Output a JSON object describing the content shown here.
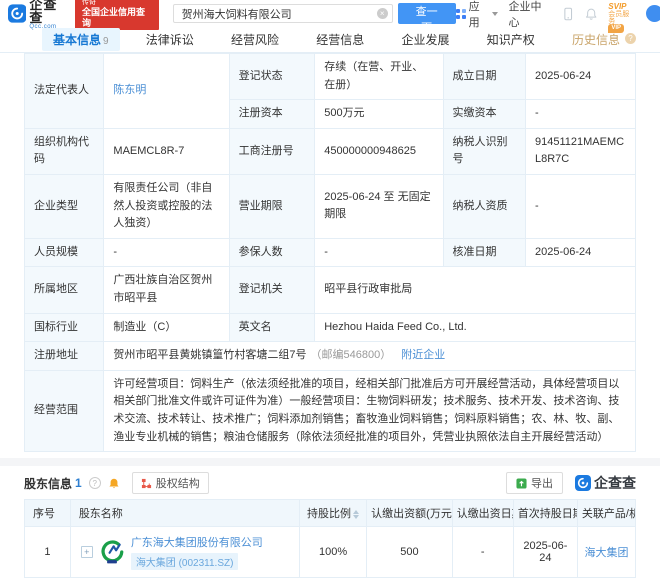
{
  "icons": {
    "clear": "×",
    "plus": "+",
    "help": "?",
    "info": "?"
  },
  "header": {
    "logo_cn": "企查查",
    "logo_en": "Qcc.com",
    "promo_line1": "传奇",
    "promo_line2": "全国企业信用查询",
    "search_value": "贺州海大饲料有限公司",
    "search_button": "查一下",
    "nav_app": "应用",
    "nav_center": "企业中心",
    "svip_line1": "SVIP",
    "svip_line2": "会员服务"
  },
  "tabs": {
    "basic": "基本信息",
    "basic_count": "9",
    "legal": "法律诉讼",
    "risk": "经营风险",
    "operation": "经营信息",
    "development": "企业发展",
    "ip": "知识产权",
    "history": "历史信息",
    "history_vip": "VIP"
  },
  "info": {
    "legal_rep_label": "法定代表人",
    "legal_rep_value": "陈东明",
    "reg_status_label": "登记状态",
    "reg_status_value": "存续（在营、开业、在册）",
    "est_date_label": "成立日期",
    "est_date_value": "2025-06-24",
    "reg_capital_label": "注册资本",
    "reg_capital_value": "500万元",
    "paid_capital_label": "实缴资本",
    "paid_capital_value": "-",
    "org_code_label": "组织机构代码",
    "org_code_value": "MAEMCL8R-7",
    "biz_reg_no_label": "工商注册号",
    "biz_reg_no_value": "450000000948625",
    "taxpayer_id_label": "纳税人识别号",
    "taxpayer_id_value": "91451121MAEMCL8R7C",
    "company_type_label": "企业类型",
    "company_type_value": "有限责任公司（非自然人投资或控股的法人独资）",
    "biz_term_label": "营业期限",
    "biz_term_value": "2025-06-24 至 无固定期限",
    "taxpayer_qual_label": "纳税人资质",
    "taxpayer_qual_value": "-",
    "staff_size_label": "人员规模",
    "staff_size_value": "-",
    "insured_label": "参保人数",
    "insured_value": "-",
    "approval_date_label": "核准日期",
    "approval_date_value": "2025-06-24",
    "region_label": "所属地区",
    "region_value": "广西壮族自治区贺州市昭平县",
    "reg_authority_label": "登记机关",
    "reg_authority_value": "昭平县行政审批局",
    "industry_label": "国标行业",
    "industry_value": "制造业（C）",
    "en_name_label": "英文名",
    "en_name_value": "Hezhou Haida Feed Co., Ltd.",
    "address_label": "注册地址",
    "address_value": "贺州市昭平县黄姚镇篁竹村客塘二组7号",
    "address_postcode": "（邮编546800）",
    "address_nearby": "附近企业",
    "scope_label": "经营范围",
    "scope_value": "许可经营项目：饲料生产（依法须经批准的项目，经相关部门批准后方可开展经营活动，具体经营项目以相关部门批准文件或许可证件为准）一般经营项目：生物饲料研发；技术服务、技术开发、技术咨询、技术交流、技术转让、技术推广；饲料添加剂销售；畜牧渔业饲料销售；饲料原料销售；农、林、牧、副、渔业专业机械的销售；粮油仓储服务（除依法须经批准的项目外，凭营业执照依法自主开展经营活动）"
  },
  "shareholders": {
    "title": "股东信息",
    "count": "1",
    "equity_btn": "股权结构",
    "export_btn": "导出",
    "watermark": "企查查",
    "columns": [
      "序号",
      "股东名称",
      "持股比例",
      "认缴出资额(万元)",
      "认缴出资日期",
      "首次持股日期",
      "关联产品/机构"
    ],
    "rows": [
      {
        "no": "1",
        "name": "广东海大集团股份有限公司",
        "stock_badge": "海大集团 (002311.SZ)",
        "ratio": "100%",
        "amount": "500",
        "date": "-",
        "first_date": "2025-06-24",
        "related": "海大集团"
      }
    ]
  }
}
